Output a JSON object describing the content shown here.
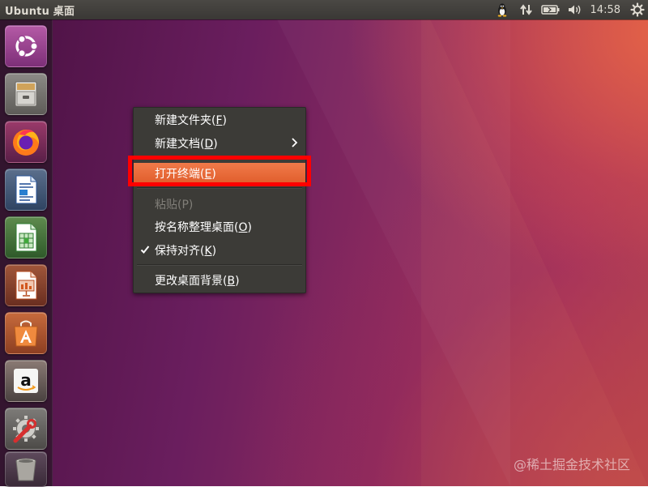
{
  "top_panel": {
    "title": "Ubuntu 桌面",
    "clock": "14:58",
    "tray_icons": [
      "tux-icon",
      "network-arrows-icon",
      "battery-icon",
      "volume-icon",
      "system-gear-icon"
    ]
  },
  "launcher": {
    "items": [
      {
        "name": "ubuntu-dash",
        "icon": "ubuntu-logo-icon"
      },
      {
        "name": "files",
        "icon": "file-cabinet-icon"
      },
      {
        "name": "firefox",
        "icon": "firefox-icon"
      },
      {
        "name": "libreoffice-writer",
        "icon": "writer-doc-icon"
      },
      {
        "name": "libreoffice-calc",
        "icon": "calc-sheet-icon"
      },
      {
        "name": "libreoffice-impress",
        "icon": "impress-slide-icon"
      },
      {
        "name": "ubuntu-software",
        "icon": "software-bag-icon"
      },
      {
        "name": "amazon",
        "icon": "amazon-icon"
      },
      {
        "name": "system-settings",
        "icon": "settings-wrench-icon"
      },
      {
        "name": "trash",
        "icon": "trash-icon"
      }
    ]
  },
  "context_menu": {
    "items": [
      {
        "label": "新建文件夹(F)",
        "prefix": "新建文件夹(",
        "mnemonic": "F",
        "suffix": ")"
      },
      {
        "label": "新建文档(D)",
        "prefix": "新建文档(",
        "mnemonic": "D",
        "suffix": ")",
        "submenu": true
      },
      {
        "label": "打开终端(E)",
        "prefix": "打开终端(",
        "mnemonic": "E",
        "suffix": ")",
        "active": true
      },
      {
        "label": "粘贴(P)",
        "prefix": "粘贴(",
        "mnemonic": "P",
        "suffix": ")",
        "disabled": true
      },
      {
        "label": "按名称整理桌面(O)",
        "prefix": "按名称整理桌面(",
        "mnemonic": "O",
        "suffix": ")"
      },
      {
        "label": "保持对齐(K)",
        "prefix": "保持对齐(",
        "mnemonic": "K",
        "suffix": ")",
        "checked": true
      },
      {
        "label": "更改桌面背景(B)",
        "prefix": "更改桌面背景(",
        "mnemonic": "B",
        "suffix": ")"
      }
    ]
  },
  "colors": {
    "menu_bg": "#3c3b37",
    "active_item": "#e8683a",
    "highlight_border": "#ff0000"
  },
  "watermark": "@稀土掘金技术社区"
}
